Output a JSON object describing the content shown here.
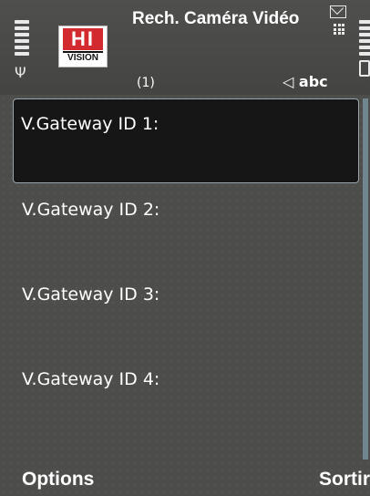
{
  "header": {
    "title": "Rech. Caméra Vidéo",
    "counter": "(1)",
    "input_mode": "abc",
    "logo_top": "HI",
    "logo_bottom": "VISION"
  },
  "list": {
    "items": [
      {
        "label": "V.Gateway ID 1:"
      },
      {
        "label": "V.Gateway ID 2:"
      },
      {
        "label": "V.Gateway ID 3:"
      },
      {
        "label": "V.Gateway ID 4:"
      }
    ],
    "selected_index": 0
  },
  "softkeys": {
    "left": "Options",
    "right": "Sortir"
  },
  "icons": {
    "signal": "signal-strength-icon",
    "antenna": "antenna-icon",
    "battery": "battery-icon",
    "message": "envelope-icon",
    "menu": "grid-menu-icon",
    "input": "pen-input-icon"
  },
  "colors": {
    "background": "#4d4d4b",
    "selection": "#161616",
    "logo_red": "#d22a2e",
    "scrollbar": "#7fa1ad"
  }
}
